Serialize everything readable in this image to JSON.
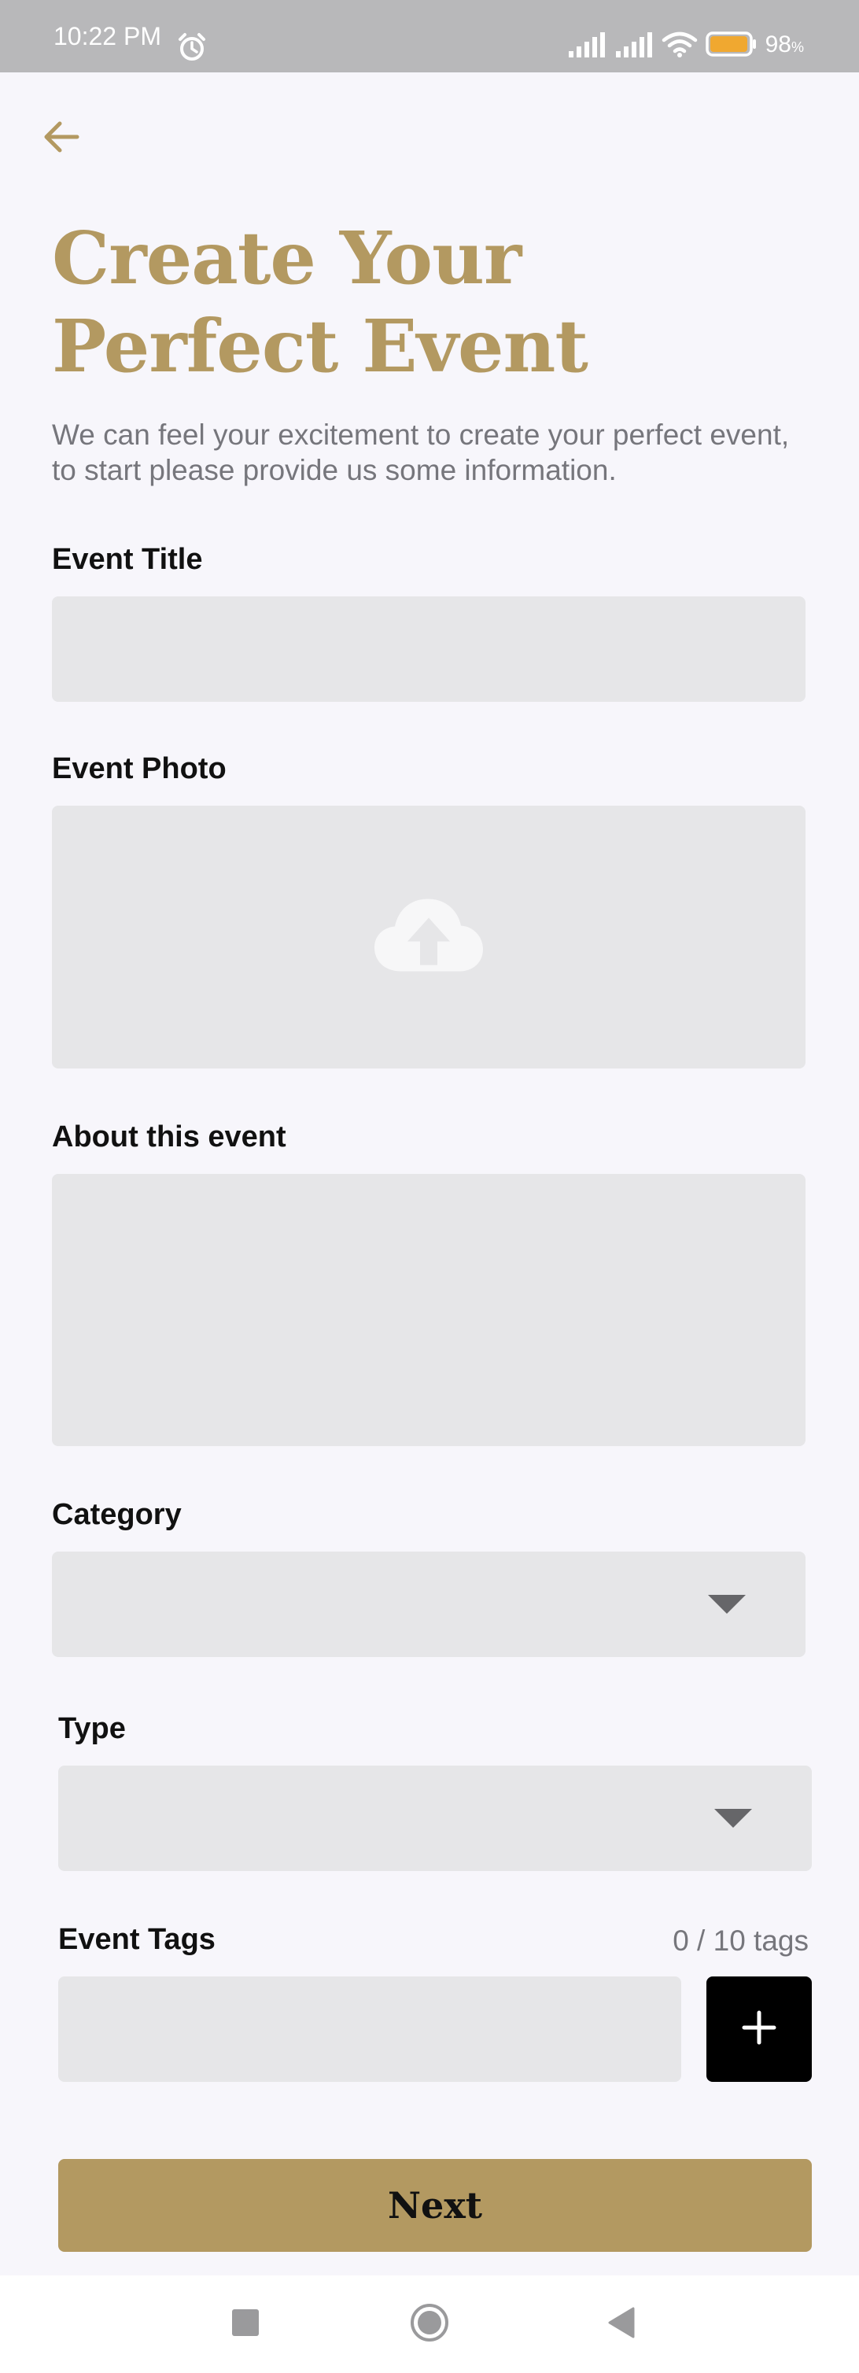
{
  "status_bar": {
    "time": "10:22 PM",
    "battery_percent": "98",
    "battery_unit": "%",
    "battery_level": 0.98,
    "battery_color": "#f0a830"
  },
  "header": {
    "back_icon": "arrow-left-icon",
    "title": "Create Your Perfect Event",
    "subtitle": "We can feel your excitement to create your perfect event, to start please provide us some information."
  },
  "form": {
    "event_title": {
      "label": "Event Title",
      "value": ""
    },
    "event_photo": {
      "label": "Event Photo",
      "icon": "cloud-upload-icon"
    },
    "about": {
      "label": "About this event",
      "value": ""
    },
    "category": {
      "label": "Category",
      "value": "",
      "icon": "dropdown-arrow-icon"
    },
    "type": {
      "label": "Type",
      "value": "",
      "icon": "dropdown-arrow-icon"
    },
    "tags": {
      "label": "Event Tags",
      "count": "0 / 10 tags",
      "value": "",
      "add_icon": "plus-icon"
    }
  },
  "actions": {
    "next_label": "Next"
  },
  "nav_bar": {
    "recents_icon": "square-icon",
    "home_icon": "circle-icon",
    "back_icon": "triangle-back-icon"
  },
  "colors": {
    "accent": "#b39961",
    "background": "#f7f6fb",
    "input_bg": "#e6e6e8",
    "status_bar": "#b8b8ba"
  }
}
